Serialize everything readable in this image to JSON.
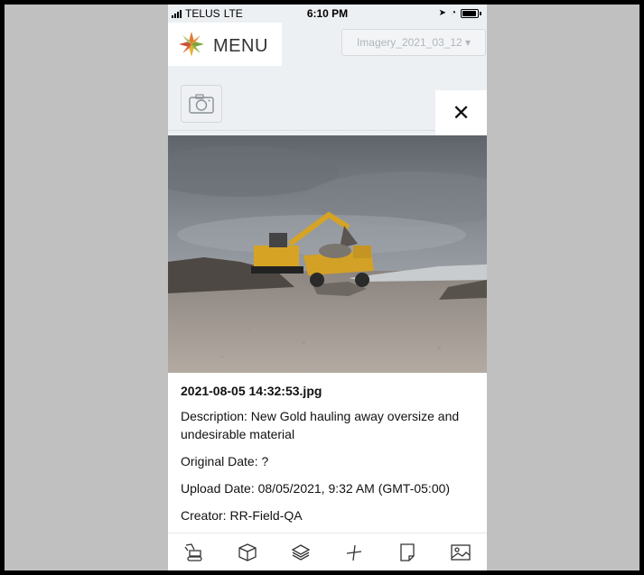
{
  "status_bar": {
    "carrier": "TELUS",
    "network": "LTE",
    "time": "6:10 PM"
  },
  "header": {
    "menu_label": "MENU",
    "imagery_select": "Imagery_2021_03_12 ▾"
  },
  "detail": {
    "close_label": "✕",
    "file_name": "2021-08-05 14:32:53.jpg",
    "description": "Description: New Gold hauling away oversize and undesirable material",
    "original_date": "Original Date: ?",
    "upload_date": "Upload Date: 08/05/2021, 9:32 AM (GMT-05:00)",
    "creator": "Creator: RR-Field-QA"
  },
  "toolbar": {
    "tools": [
      "excavator-icon",
      "box-icon",
      "layers-icon",
      "measure-icon",
      "note-icon",
      "image-icon"
    ]
  },
  "colors": {
    "background": "#c0c0c0",
    "panel": "#edf0f3",
    "text": "#111111",
    "muted": "#b0b6bd"
  }
}
